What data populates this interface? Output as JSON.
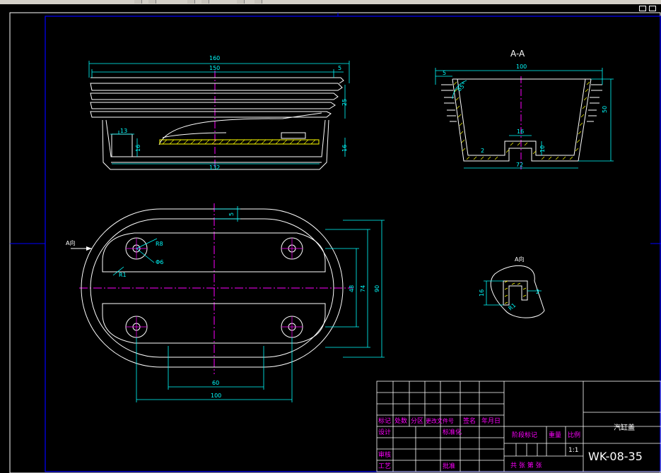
{
  "toolbar": {
    "icons": [
      "new-icon",
      "open-icon",
      "save-icon",
      "print-icon",
      "undo-icon",
      "layer-icon"
    ]
  },
  "colors": {
    "background": "#000000",
    "outline": "#ffffff",
    "dimension": "#00ffff",
    "centerline": "#ff00ff",
    "frame": "#0000ff",
    "hatch": "#ffff00",
    "title_text": "#ff00ff"
  },
  "views": {
    "front": {
      "dims": {
        "overall": "160",
        "inner": "150",
        "base": "132",
        "step": "5",
        "ribs": "25",
        "height": "16",
        "slot_w": "13",
        "slot_h": "16"
      }
    },
    "section": {
      "title": "A-A",
      "dims": {
        "width": "100",
        "bottom": "72",
        "center": "16",
        "offset": "5",
        "height": "50",
        "wall": "2",
        "depth": "10",
        "angle": "65°"
      }
    },
    "plan": {
      "arrow_label": "A向",
      "dims": {
        "top_offset": "5",
        "r8": "R8",
        "phi6": "Φ6",
        "r1": "R1",
        "h48": "48",
        "h74": "74",
        "h90": "90",
        "w60": "60",
        "w100": "100"
      }
    },
    "detail": {
      "label": "A向",
      "dims": {
        "h": "16",
        "w": "2",
        "r": "R1"
      }
    }
  },
  "title_block": {
    "labels": {
      "mark": "标记",
      "count": "处数",
      "zone": "分区",
      "change_doc": "更改文件号",
      "sign": "签名",
      "date": "年月日",
      "design": "设计",
      "standard": "标准化",
      "stage": "阶段标记",
      "weight": "重量",
      "scale": "比例",
      "check": "审核",
      "process": "工艺",
      "approve": "批准",
      "sheets": "共  张 第  张"
    },
    "part_name": "汽缸盖",
    "scale_value": "1:1",
    "drawing_no": "WK-08-35"
  }
}
